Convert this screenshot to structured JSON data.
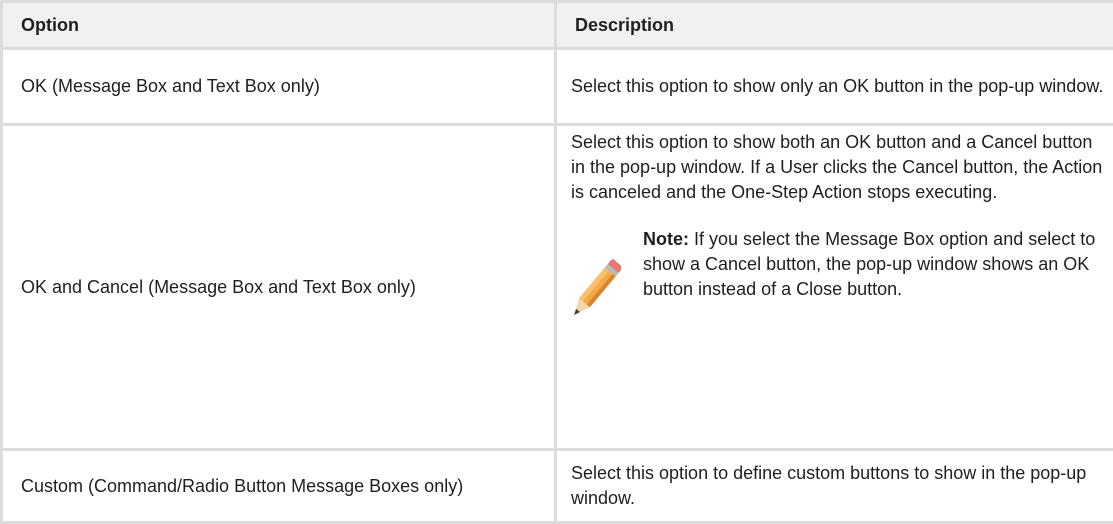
{
  "table": {
    "headers": [
      "Option",
      "Description"
    ],
    "rows": [
      {
        "option": "OK (Message Box and Text Box only)",
        "description": "Select this option to show only an OK button in the pop-up window."
      },
      {
        "option": "OK and Cancel (Message Box and Text Box only)",
        "description": "Select this option to show both an OK button and a Cancel button in the pop-up window. If a User clicks the Cancel button, the Action is canceled and the One-Step Action stops executing.",
        "note_label": "Note:",
        "note_text": "If you select the Message Box option and select to show a Cancel button, the pop-up window shows an OK button instead of a Close button.",
        "note_icon": "pencil-icon"
      },
      {
        "option": "Custom (Command/Radio Button Message Boxes only)",
        "description": "Select this option to define custom buttons to show in the pop-up window."
      }
    ]
  }
}
